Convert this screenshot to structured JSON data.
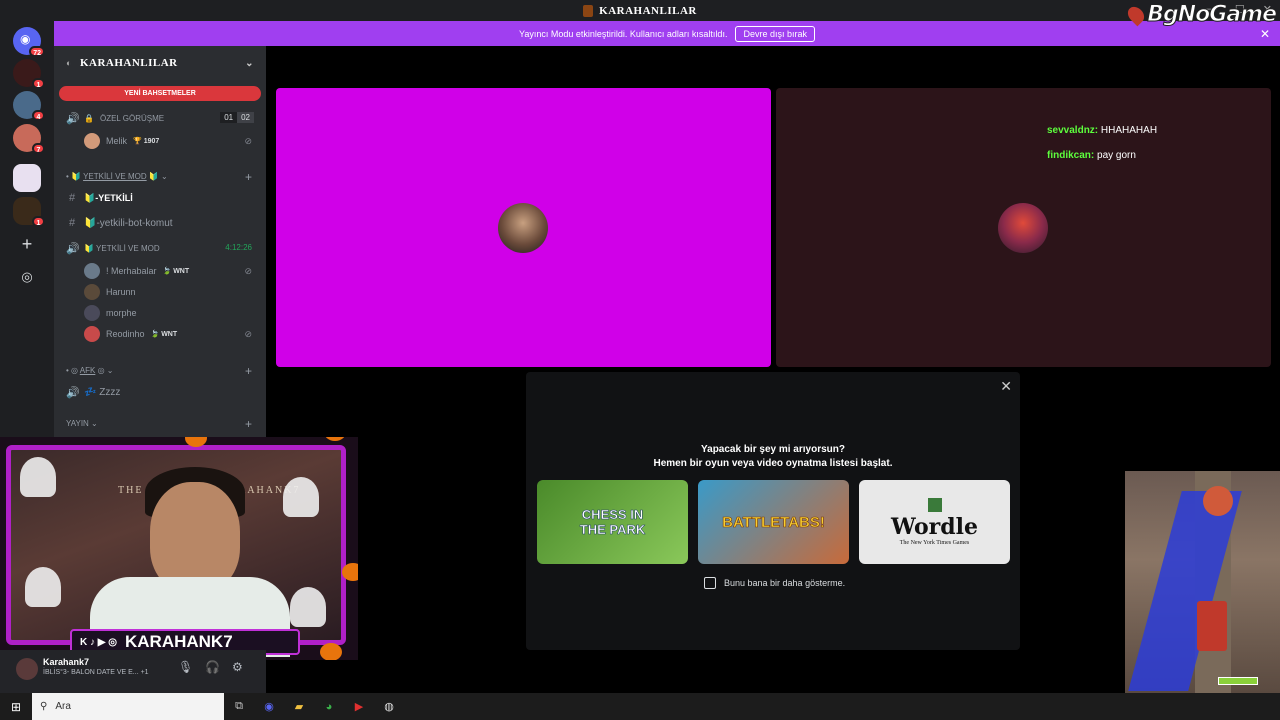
{
  "window": {
    "title": "KARAHANLILAR"
  },
  "watermark": "BgNoGame",
  "banner": {
    "text": "Yayıncı Modu etkinleştirildi. Kullanıcı adları kısaltıldı.",
    "button": "Devre dışı bırak"
  },
  "servers": [
    {
      "badge": "72"
    },
    {
      "badge": "1"
    },
    {
      "badge": "4"
    },
    {
      "badge": "7"
    },
    {
      "badge": ""
    },
    {
      "badge": "1"
    }
  ],
  "guild": {
    "name": "KARAHANLILAR",
    "new_mentions": "YENİ BAHSETMELER",
    "voice1": {
      "name": "ÖZEL GÖRÜŞME",
      "count_a": "01",
      "count_b": "02"
    },
    "voice1_user": {
      "name": "Melik",
      "tag": "1907"
    },
    "category1": "YETKİLİ VE MOD",
    "text1": "-YETKİLİ",
    "text2": "-yetkili-bot-komut",
    "voice2": {
      "name": "YETKİLİ VE MOD",
      "timer": "4:12:26"
    },
    "voice2_users": [
      {
        "name": "! Merhabalar",
        "tag": "WNT"
      },
      {
        "name": "Harunn",
        "tag": ""
      },
      {
        "name": "morphe",
        "tag": ""
      },
      {
        "name": "Reodinho",
        "tag": "WNT"
      }
    ],
    "category2": "AFK",
    "afk_channel": "Zzzz",
    "category3": "YAYIN"
  },
  "chat": [
    {
      "user": "sevvaldnz:",
      "text": "HHAHAHAH"
    },
    {
      "user": "findikcan:",
      "text": "pay gorn"
    }
  ],
  "activity": {
    "line1": "Yapacak bir şey mi arıyorsun?",
    "line2": "Hemen bir oyun veya video oynatma listesi başlat.",
    "cards": [
      {
        "title": "CHESS IN THE PARK",
        "colors": [
          "#5c9c3a",
          "#9bd46a"
        ]
      },
      {
        "title": "BATTLETABS!",
        "colors": [
          "#4aa0c8",
          "#e07030"
        ]
      },
      {
        "title": "Wordle",
        "subtitle": "The New York Times Games"
      }
    ],
    "checkbox": "Bunu bana bir daha gösterme."
  },
  "webcam": {
    "overlay_name": "KARAHANK7",
    "world_title": "THE WORLD OF KARAHANK7"
  },
  "userbar": {
    "name": "Karahank7",
    "status": "İBLİS°3- BALON DATE VE E... +1"
  },
  "taskbar": {
    "search_placeholder": "Ara"
  }
}
